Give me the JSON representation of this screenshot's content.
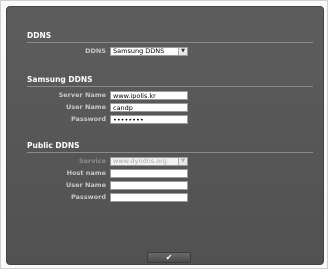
{
  "ddns": {
    "section_title": "DDNS",
    "label": "DDNS",
    "selected": "Samsung DDNS"
  },
  "samsung": {
    "section_title": "Samsung DDNS",
    "server_label": "Server Name",
    "server_value": "www.ipolis.kr",
    "user_label": "User Name",
    "user_value": "candp",
    "password_label": "Password",
    "password_value": "••••••••"
  },
  "public": {
    "section_title": "Public DDNS",
    "service_label": "Service",
    "service_value": "www.dyndns.org",
    "host_label": "Host name",
    "host_value": "",
    "user_label": "User Name",
    "user_value": "",
    "password_label": "Password",
    "password_value": ""
  },
  "actions": {
    "ok_glyph": "✔"
  },
  "icons": {
    "dropdown": "chevron-down-icon",
    "ok": "checkmark-icon"
  }
}
